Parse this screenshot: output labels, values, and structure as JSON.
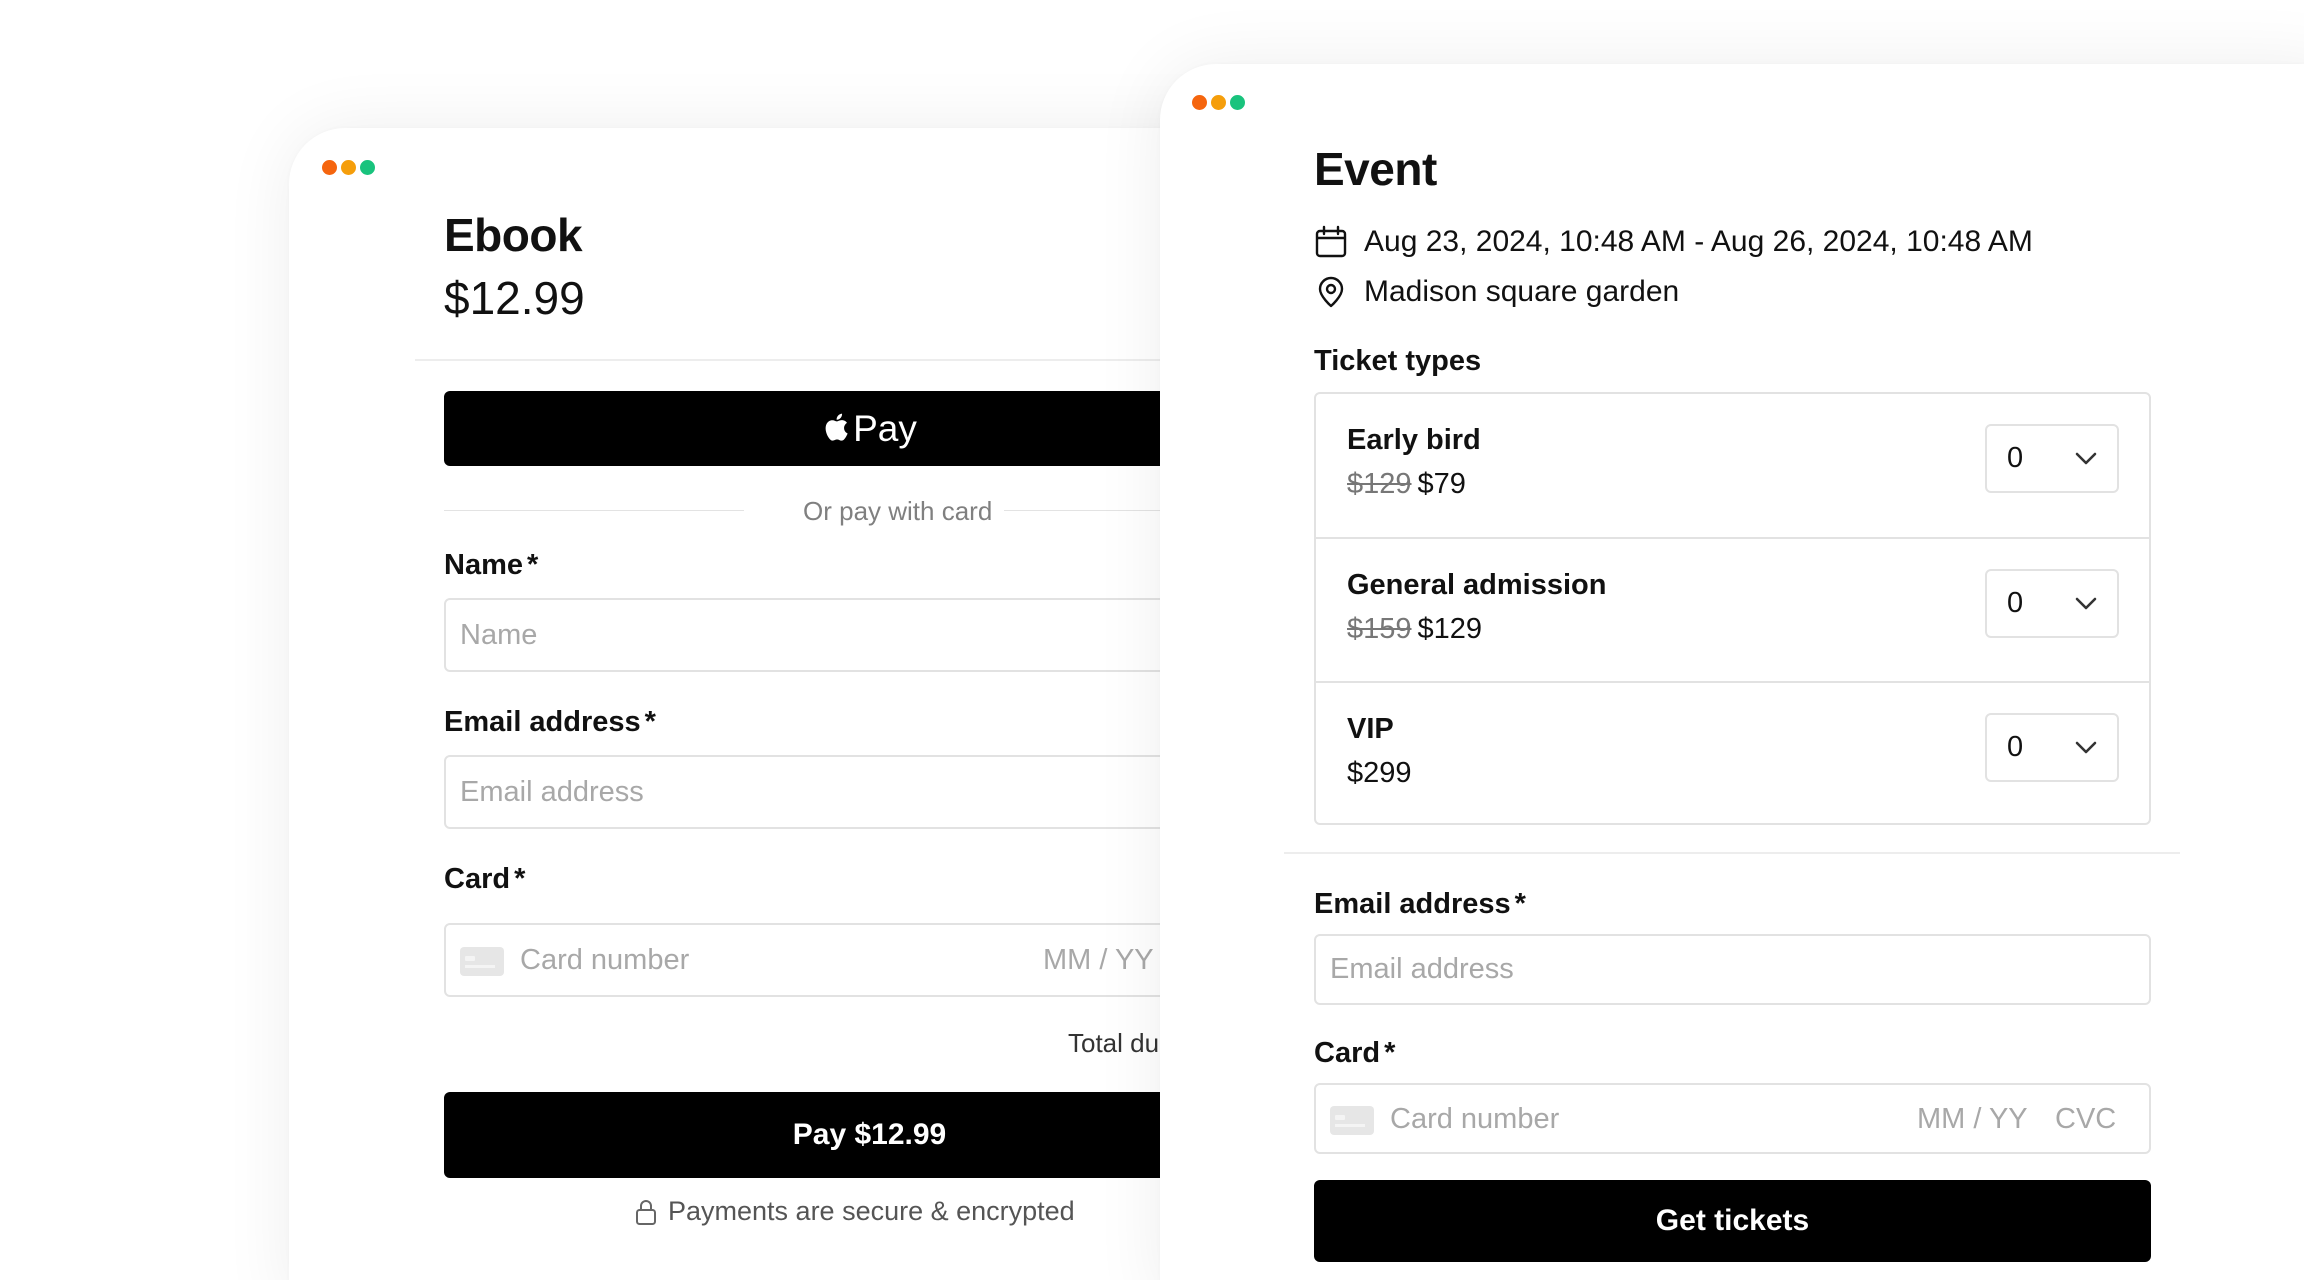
{
  "ebook": {
    "title": "Ebook",
    "price": "$12.99",
    "apple_pay_label": "Pay",
    "or_text": "Or pay with card",
    "name_label": "Name",
    "name_placeholder": "Name",
    "email_label": "Email address",
    "email_placeholder": "Email address",
    "card_label": "Card",
    "card_number_placeholder": "Card number",
    "card_expiry_placeholder": "MM / YY",
    "total_label": "Total du",
    "pay_button": "Pay $12.99",
    "secure_text": "Payments are secure & encrypted"
  },
  "event": {
    "title": "Event",
    "date_range": "Aug 23, 2024, 10:48 AM - Aug 26, 2024, 10:48 AM",
    "location": "Madison square garden",
    "ticket_types_label": "Ticket types",
    "tickets": [
      {
        "name": "Early bird",
        "old_price": "$129",
        "price": "$79",
        "qty": "0"
      },
      {
        "name": "General admission",
        "old_price": "$159",
        "price": "$129",
        "qty": "0"
      },
      {
        "name": "VIP",
        "old_price": "",
        "price": "$299",
        "qty": "0"
      }
    ],
    "email_label": "Email address",
    "email_placeholder": "Email address",
    "card_label": "Card",
    "card_number_placeholder": "Card number",
    "card_expiry_placeholder": "MM / YY",
    "card_cvc_placeholder": "CVC",
    "get_tickets_button": "Get tickets"
  },
  "required_marker": "*",
  "colors": {
    "dot_red": "#f5650e",
    "dot_yellow": "#f59e0b",
    "dot_green": "#19c37d",
    "button_bg": "#000000"
  },
  "icons": [
    "apple-logo-icon",
    "card-icon",
    "lock-icon",
    "calendar-icon",
    "location-pin-icon",
    "chevron-down-icon"
  ]
}
